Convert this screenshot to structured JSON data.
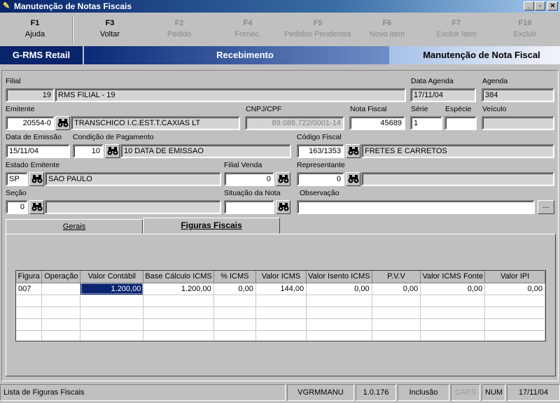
{
  "window": {
    "title": "Manutenção de Notas Fiscais",
    "buttons": [
      "_",
      "▫",
      "✕"
    ]
  },
  "fkeys": [
    {
      "key": "F1",
      "label": "Ajuda",
      "enabled": true
    },
    {
      "key": "F3",
      "label": "Voltar",
      "enabled": true
    },
    {
      "key": "F2",
      "label": "Pedido",
      "enabled": false
    },
    {
      "key": "F4",
      "label": "Fornec.",
      "enabled": false
    },
    {
      "key": "F5",
      "label": "Pedidos Pendentes",
      "enabled": false
    },
    {
      "key": "F6",
      "label": "Novo Item",
      "enabled": false
    },
    {
      "key": "F7",
      "label": "Excluir Item",
      "enabled": false
    },
    {
      "key": "F10",
      "label": "Excluir",
      "enabled": false
    }
  ],
  "banner": {
    "app": "G-RMS Retail",
    "module": "Recebimento",
    "screen": "Manutenção de Nota Fiscal"
  },
  "form": {
    "filial": {
      "label": "Filial",
      "code": "19",
      "name": "RMS FILIAL - 19"
    },
    "data_agenda": {
      "label": "Data Agenda",
      "value": "17/11/04"
    },
    "agenda": {
      "label": "Agenda",
      "value": "384"
    },
    "emitente": {
      "label": "Emitente",
      "code": "20554-0",
      "name": "TRANSCHICO I.C.EST.T.CAXIAS LT"
    },
    "cnpj": {
      "label": "CNPJ/CPF",
      "value": "89.086.722/0001-14"
    },
    "nota_fiscal": {
      "label": "Nota Fiscal",
      "value": "45689"
    },
    "serie": {
      "label": "Série",
      "value": "1"
    },
    "especie": {
      "label": "Espécie",
      "value": ""
    },
    "veiculo": {
      "label": "Veículo",
      "value": ""
    },
    "data_emissao": {
      "label": "Data de Emissão",
      "value": "15/11/04"
    },
    "cond_pagamento": {
      "label": "Condição de Pagamento",
      "code": "10",
      "name": "10 DATA DE EMISSAO"
    },
    "codigo_fiscal": {
      "label": "Código Fiscal",
      "code": "163/1353",
      "name": "FRETES E CARRETOS"
    },
    "estado_emitente": {
      "label": "Estado Emitente",
      "code": "SP",
      "name": "SAO PAULO"
    },
    "filial_venda": {
      "label": "Filial Venda",
      "value": "0"
    },
    "representante": {
      "label": "Representante",
      "code": "0",
      "name": ""
    },
    "secao": {
      "label": "Seção",
      "code": "0",
      "name": ""
    },
    "situacao_nota": {
      "label": "Situação da Nota",
      "value": ""
    },
    "observacao": {
      "label": "Observação",
      "value": "",
      "button": "..."
    }
  },
  "tabs": [
    {
      "label": "Gerais",
      "active": false
    },
    {
      "label": "Figuras Fiscais",
      "active": true
    }
  ],
  "grid": {
    "columns": [
      "Figura",
      "Operação",
      "Valor Contábil",
      "Base Cálculo ICMS",
      "% ICMS",
      "Valor ICMS",
      "Valor Isento ICMS",
      "P.V.V",
      "Valor ICMS Fonte",
      "Valor IPI"
    ],
    "rows": [
      [
        "007",
        "",
        "1.200,00",
        "1.200,00",
        "0,00",
        "144,00",
        "0,00",
        "0,00",
        "0,00",
        "0,00"
      ]
    ],
    "empty_rows": 4
  },
  "status": {
    "message": "Lista de Figuras Fiscais",
    "user": "VGRMMANU",
    "version": "1.0.176",
    "mode": "Inclusão",
    "caps": "CAPS",
    "num": "NUM",
    "date": "17/11/04"
  }
}
